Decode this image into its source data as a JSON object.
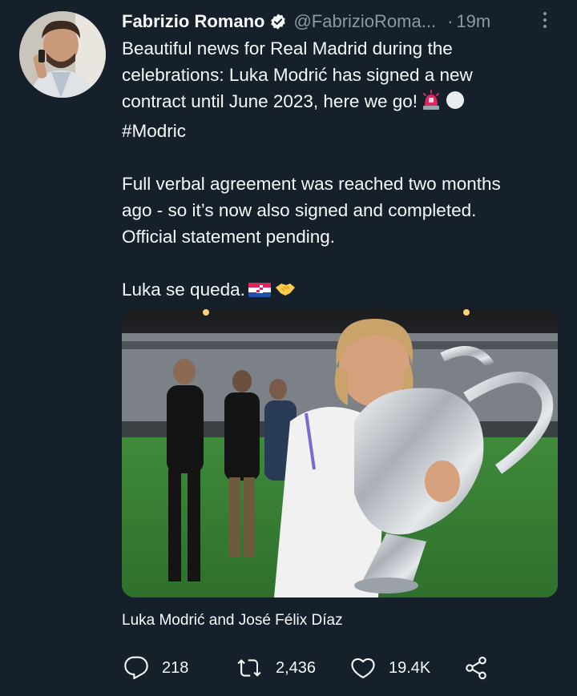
{
  "tweet": {
    "author_name": "Fabrizio Romano",
    "handle": "@FabrizioRoma...",
    "separator": "·",
    "time": "19m",
    "text_lines": [
      "Beautiful news for Real Madrid during the",
      "celebrations: Luka Modrić has signed a new",
      "contract until June 2023, here we go!"
    ],
    "hashtag": "#Modric",
    "paragraph2_lines": [
      "Full verbal agreement was reached two months",
      "ago - so it’s now also signed and completed.",
      "Official statement pending."
    ],
    "paragraph3": "Luka se queda.",
    "media_caption": "Luka Modrić and José Félix Díaz"
  },
  "actions": {
    "replies": "218",
    "retweets": "2,436",
    "likes": "19.4K"
  },
  "icons": {
    "verified": "verified-badge-icon",
    "more": "more-options-icon",
    "reply": "reply-icon",
    "retweet": "retweet-icon",
    "like": "heart-icon",
    "share": "share-icon"
  },
  "colors": {
    "background": "#15202b",
    "text": "#f7f9f9",
    "secondary": "#8b98a5"
  }
}
